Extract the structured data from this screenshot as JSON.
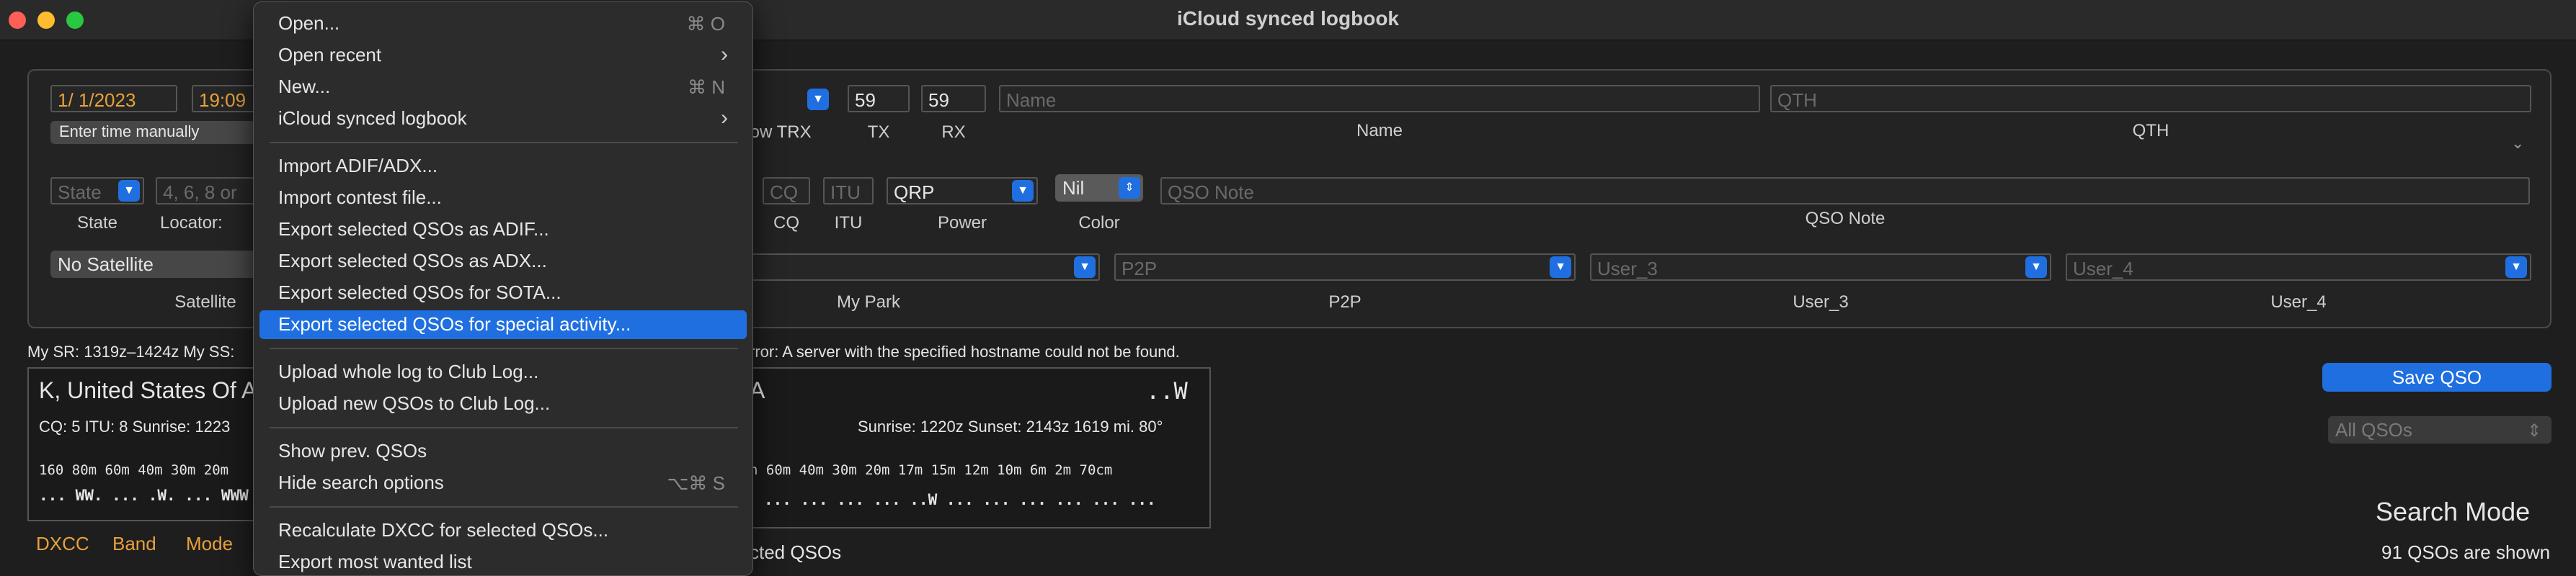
{
  "window": {
    "title": "iCloud synced logbook"
  },
  "form": {
    "date": "1/  1/2023",
    "time": "19:09",
    "enter_time": "Enter time manually",
    "follow_trx": "llow TRX",
    "tx_value": "59",
    "tx_label": "TX",
    "rx_value": "59",
    "rx_label": "RX",
    "name_placeholder": "Name",
    "name_label": "Name",
    "qth_placeholder": "QTH",
    "qth_label": "QTH",
    "state_placeholder": "State",
    "state_label": "State",
    "locator_placeholder": "4, 6, 8 or",
    "locator_label": "Locator:",
    "cq_placeholder": "CQ",
    "cq_label": "CQ",
    "itu_placeholder": "ITU",
    "itu_label": "ITU",
    "power_value": "QRP",
    "power_label": "Power",
    "color_value": "Nil",
    "color_label": "Color",
    "qso_note_placeholder": "QSO Note",
    "qso_note_label": "QSO Note",
    "satellite_value": "No Satellite",
    "satellite_label": "Satellite",
    "mypark_label": "My Park",
    "p2p_placeholder": "P2P",
    "p2p_label": "P2P",
    "user3_placeholder": "User_3",
    "user3_label": "User_3",
    "user4_placeholder": "User_4",
    "user4_label": "User_4"
  },
  "status": {
    "left": "My SR: 1319z–1424z  My SS: ",
    "error": "rror: A server with the specified hostname could not be found."
  },
  "info_left": {
    "title": "K, United States Of A",
    "details": "CQ: 5  ITU: 8  Sunrise: 1223",
    "bands": "160  80m  60m  40m  30m  20m",
    "marks": "... WW.  ...  .W.  ...  WWW"
  },
  "info_right": {
    "title": "A",
    "title_right": "..W",
    "details": "Sunrise: 1220z  Sunset: 2143z  1619 mi.  80°",
    "bands": "n  60m  40m  30m  20m  17m  15m  12m  10m   6m   2m  70cm",
    "marks": "...  ...  ...  ...  ..W  ...  ...  ...  ...  ...  ..."
  },
  "bottom_links": {
    "dxcc": "DXCC",
    "band": "Band",
    "mode": "Mode"
  },
  "bottom_text": "cted QSOs",
  "right_panel": {
    "save_qso": "Save QSO",
    "filter": "All QSOs",
    "search_mode": "Search Mode",
    "count": "91 QSOs are shown"
  },
  "menu": {
    "items": [
      {
        "label": "Open...",
        "shortcut": "⌘ O"
      },
      {
        "label": "Open recent"
      },
      {
        "label": "New...",
        "shortcut": "⌘ N"
      },
      {
        "label": "iCloud synced logbook"
      },
      {
        "label": "Import ADIF/ADX..."
      },
      {
        "label": "Import contest file..."
      },
      {
        "label": "Export selected QSOs as ADIF..."
      },
      {
        "label": "Export selected QSOs as ADX..."
      },
      {
        "label": "Export selected QSOs for SOTA..."
      },
      {
        "label": "Export selected QSOs for special activity..."
      },
      {
        "label": "Upload whole log to Club Log..."
      },
      {
        "label": "Upload new QSOs to Club Log..."
      },
      {
        "label": "Show prev. QSOs"
      },
      {
        "label": "Hide search options",
        "shortcut": "⌥⌘ S"
      },
      {
        "label": "Recalculate DXCC for selected QSOs..."
      },
      {
        "label": "Export most wanted list"
      }
    ]
  },
  "colors": {
    "accent": "#1f6fe0",
    "orange": "#e8a13a"
  },
  "icons": {
    "submenu": "chevron-right-icon",
    "popup": "chevron-updown-icon"
  }
}
